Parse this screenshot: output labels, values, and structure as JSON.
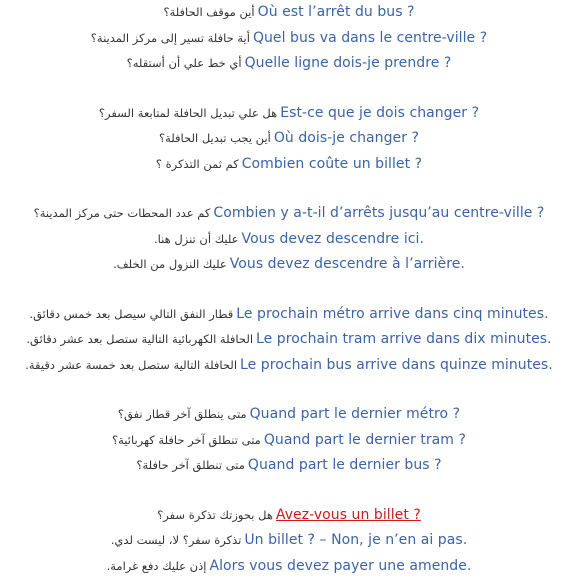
{
  "groups": [
    {
      "rows": [
        {
          "ar": "أين موقف الحافلة؟",
          "fr": "Où est l’arrêt du bus ?"
        },
        {
          "ar": "أية حافلة تسير إلى مركز المدينة؟",
          "fr": "Quel bus va dans le centre-ville ?"
        },
        {
          "ar": "أي خط علي أن أستقله؟",
          "fr": "Quelle ligne dois-je prendre ?"
        }
      ]
    },
    {
      "rows": [
        {
          "ar": "هل علي تبديل الحافلة لمتابعة السفر؟",
          "fr": "Est-ce que je dois changer ?"
        },
        {
          "ar": "أين يجب تبديل الحافلة؟",
          "fr": "Où dois-je changer ?"
        },
        {
          "ar": "كم ثمن التذكرة ؟",
          "fr": "Combien coûte un billet ?"
        }
      ]
    },
    {
      "rows": [
        {
          "ar": "كم عدد المحطات حتى مركز المدينة؟",
          "fr": "Combien y a-t-il d’arrêts jusqu’au centre-ville ?"
        },
        {
          "ar": "عليك أن تنزل هنا.",
          "fr": "Vous devez descendre ici."
        },
        {
          "ar": "عليك النزول من الخلف.",
          "fr": "Vous devez descendre à l’arrière."
        }
      ]
    },
    {
      "rows": [
        {
          "ar": "قطار النفق التالي سيصل بعد خمس دقائق.",
          "fr": "Le prochain métro arrive dans cinq minutes."
        },
        {
          "ar": "الحافلة الكهربائية التالية ستصل بعد عشر دقائق.",
          "fr": "Le prochain tram arrive dans dix minutes."
        },
        {
          "ar": "الحافلة التالية ستصل بعد خمسة عشر دقيقة.",
          "fr": "Le prochain bus arrive dans quinze minutes."
        }
      ]
    },
    {
      "rows": [
        {
          "ar": "متى ينطلق آخر قطار نفق؟",
          "fr": "Quand part le dernier métro ?"
        },
        {
          "ar": "متى تنطلق آخر حافلة كهربائية؟",
          "fr": "Quand part le dernier tram ?"
        },
        {
          "ar": "متى تنطلق آخر حافلة؟",
          "fr": "Quand part le dernier bus ?"
        }
      ]
    },
    {
      "rows": [
        {
          "ar": "هل بحوزتك تذكرة سفر؟",
          "fr": "Avez-vous un billet ?",
          "link": true
        },
        {
          "ar": "تذكرة سفر؟ لا، ليست لدي.",
          "fr": "Un billet ? – Non, je n’en ai pas."
        },
        {
          "ar": "إذن عليك دفع غرامة.",
          "fr": "Alors vous devez payer une amende."
        }
      ]
    }
  ],
  "colors": {
    "french_text": "#3a63a8",
    "arabic_text": "#333333",
    "link": "#cc1b1b"
  }
}
